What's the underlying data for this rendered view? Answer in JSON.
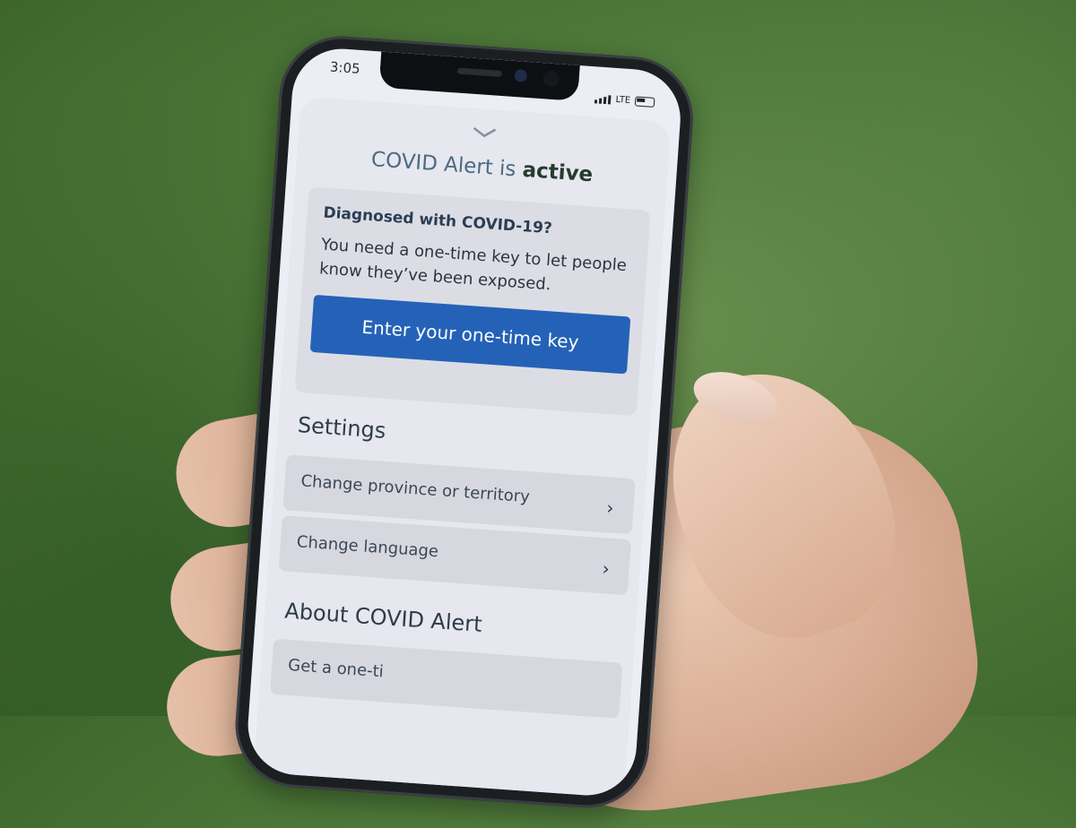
{
  "status": {
    "time": "3:05",
    "network": "LTE"
  },
  "header": {
    "title_prefix": "COVID Alert is ",
    "title_state": "active"
  },
  "diagnosis_card": {
    "heading": "Diagnosed with COVID-19?",
    "body": "You need a one-time key to let people know they’ve been exposed.",
    "button_label": "Enter your one-time key"
  },
  "settings": {
    "heading": "Settings",
    "items": [
      {
        "label": "Change province or territory"
      },
      {
        "label": "Change language"
      }
    ]
  },
  "about": {
    "heading": "About COVID Alert",
    "items": [
      {
        "label": "Get a one-ti"
      }
    ]
  },
  "colors": {
    "primary_button": "#2462b8",
    "active_text": "#243b2e",
    "background": "#4f7a3a"
  }
}
